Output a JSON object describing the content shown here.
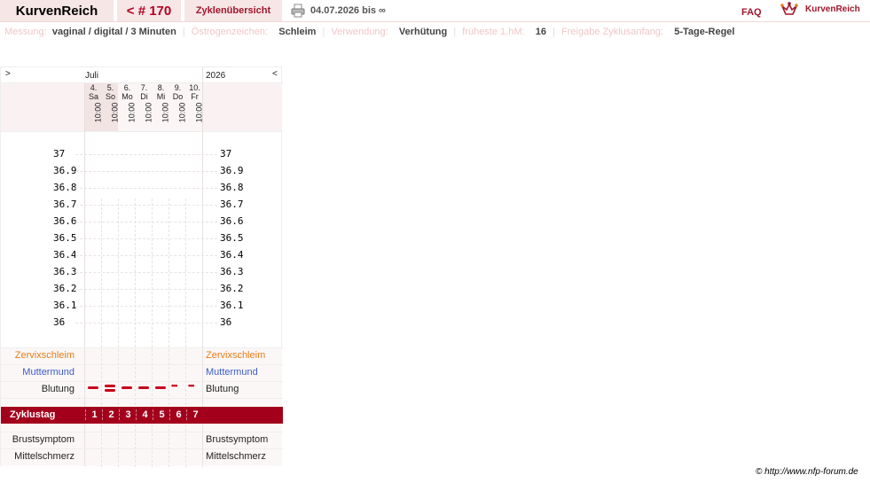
{
  "topbar": {
    "brand": "KurvenReich",
    "nav_prev": "< # 170",
    "overview": "Zyklenübersicht",
    "date_range": "04.07.2026 bis ∞",
    "faq": "FAQ",
    "logo_text": "KurvenReich",
    "printer_icon": "printer-icon",
    "logo_icon": "kurvenreich-logo-icon"
  },
  "info": [
    {
      "label": "Messung:",
      "value": "vaginal / digital / 3 Minuten"
    },
    {
      "label": "Östrogenzeichen:",
      "value": "Schleim"
    },
    {
      "label": "Verwendung:",
      "value": "Verhütung"
    },
    {
      "label": "früheste 1.hM:",
      "value": "16"
    },
    {
      "label": "Freigabe Zyklusanfang:",
      "value": "5-Tage-Regel"
    }
  ],
  "chart": {
    "nav_right": ">",
    "nav_left": "<",
    "month": "Juli",
    "year": "2026",
    "days": [
      {
        "day": "4.",
        "weekday": "Sa",
        "time": "10:00"
      },
      {
        "day": "5.",
        "weekday": "So",
        "time": "10:00"
      },
      {
        "day": "6.",
        "weekday": "Mo",
        "time": "10:00"
      },
      {
        "day": "7.",
        "weekday": "Di",
        "time": "10:00"
      },
      {
        "day": "8.",
        "weekday": "Mi",
        "time": "10:00"
      },
      {
        "day": "9.",
        "weekday": "Do",
        "time": "10:00"
      },
      {
        "day": "10.",
        "weekday": "Fr",
        "time": "10:00"
      }
    ],
    "temperatures": [
      "37",
      "36.9",
      "36.8",
      "36.7",
      "36.6",
      "36.5",
      "36.4",
      "36.3",
      "36.2",
      "36.1",
      "36"
    ],
    "rows": {
      "cervical_mucus": "Zervixschleim",
      "cervix": "Muttermund",
      "bleeding": "Blutung",
      "cycle_day": "Zyklustag",
      "breast": "Brustsymptom",
      "mittelschmerz": "Mittelschmerz"
    },
    "bleeding_strength": [
      "medium",
      "heavy",
      "medium",
      "medium",
      "medium",
      "spotting",
      "spotting"
    ],
    "cycle_days": [
      "1",
      "2",
      "3",
      "4",
      "5",
      "6",
      "7"
    ],
    "colors": {
      "mucus": "#e87d1a",
      "cervix": "#3b5cc4",
      "accent": "#a3001c",
      "bleeding": "#c8001a"
    }
  },
  "footer": {
    "copyright": "© http://www.nfp-forum.de"
  }
}
